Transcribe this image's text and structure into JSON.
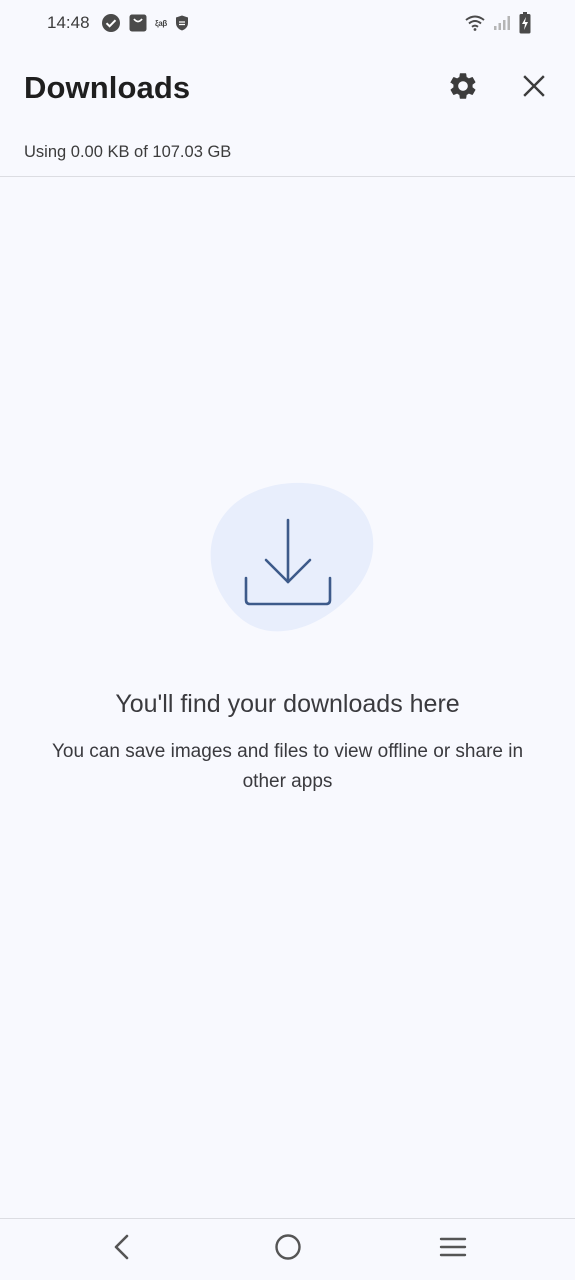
{
  "status_bar": {
    "time": "14:48",
    "notification_text": "ξaβ",
    "left_icons": [
      "check-circle-icon",
      "shopping-bag-icon",
      "app-label-icon",
      "shield-icon"
    ],
    "right_icons": [
      "wifi-icon",
      "cell-signal-icon",
      "battery-charging-icon"
    ]
  },
  "app_bar": {
    "title": "Downloads",
    "icons": [
      "gear-icon",
      "close-icon"
    ]
  },
  "storage": {
    "text": "Using 0.00 KB of 107.03 GB"
  },
  "empty_state": {
    "icon": "download-icon",
    "title": "You'll find your downloads here",
    "subtitle": "You can save images and files to view offline or share in other apps"
  },
  "nav_bar": {
    "icons": [
      "back-icon",
      "home-icon",
      "recents-icon"
    ]
  },
  "colors": {
    "background": "#f8f9fe",
    "illustration_blob": "#e8eefc",
    "illustration_stroke": "#3d5a8a",
    "text_primary": "#1f1f1f",
    "text_secondary": "#3a3a3e"
  }
}
